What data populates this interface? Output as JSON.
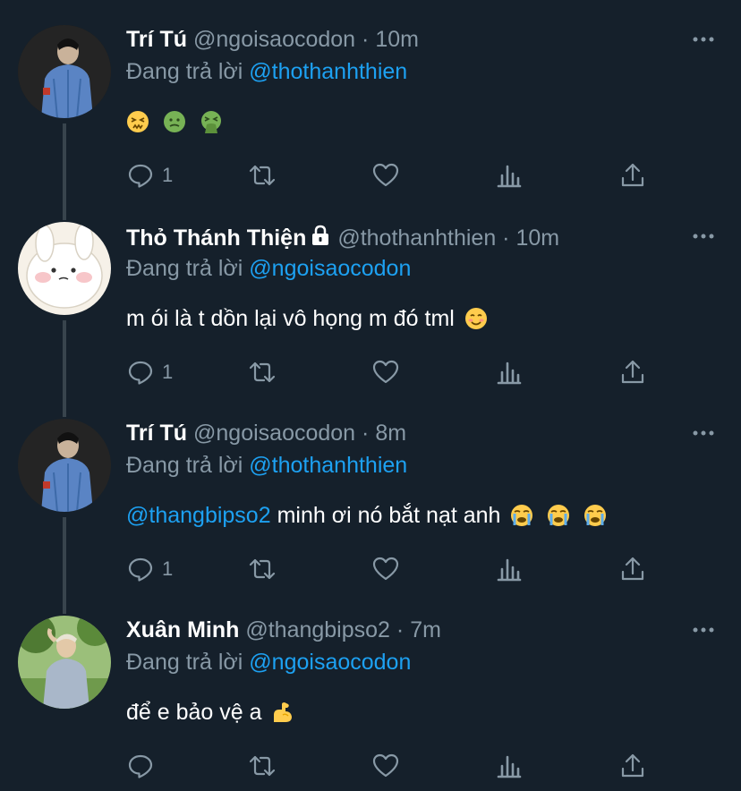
{
  "tweets": [
    {
      "name": "Trí Tú",
      "handle": "@ngoisaocodon",
      "dot": "·",
      "time": "10m",
      "reply_prefix": "Đang trả lời",
      "reply_to": "@thothanhthien",
      "text": "",
      "emojis": [
        "confounded-face",
        "nauseated-face",
        "vomiting-face"
      ],
      "reply_count": "1"
    },
    {
      "name": "Thỏ Thánh Thiện",
      "handle": "@thothanhthien",
      "dot": "·",
      "time": "10m",
      "reply_prefix": "Đang trả lời",
      "reply_to": "@ngoisaocodon",
      "text": "m ói là t dồn lại vô họng m đó tml",
      "emojis": [
        "smiling-face"
      ],
      "reply_count": "1"
    },
    {
      "name": "Trí Tú",
      "handle": "@ngoisaocodon",
      "dot": "·",
      "time": "8m",
      "reply_prefix": "Đang trả lời",
      "reply_to": "@thothanhthien",
      "mention": "@thangbipso2",
      "text": "minh ơi nó bắt nạt anh",
      "emojis": [
        "loudly-crying-face",
        "loudly-crying-face",
        "loudly-crying-face"
      ],
      "reply_count": "1"
    },
    {
      "name": "Xuân Minh",
      "handle": "@thangbipso2",
      "dot": "·",
      "time": "7m",
      "reply_prefix": "Đang trả lời",
      "reply_to": "@ngoisaocodon",
      "text": "để e bảo vệ a",
      "emojis": [
        "flexed-biceps"
      ],
      "reply_count": ""
    }
  ],
  "colors": {
    "background": "#15202b",
    "text_primary": "#ffffff",
    "text_secondary": "#8899a6",
    "link": "#1da1f2",
    "thread_line": "#38444d"
  }
}
